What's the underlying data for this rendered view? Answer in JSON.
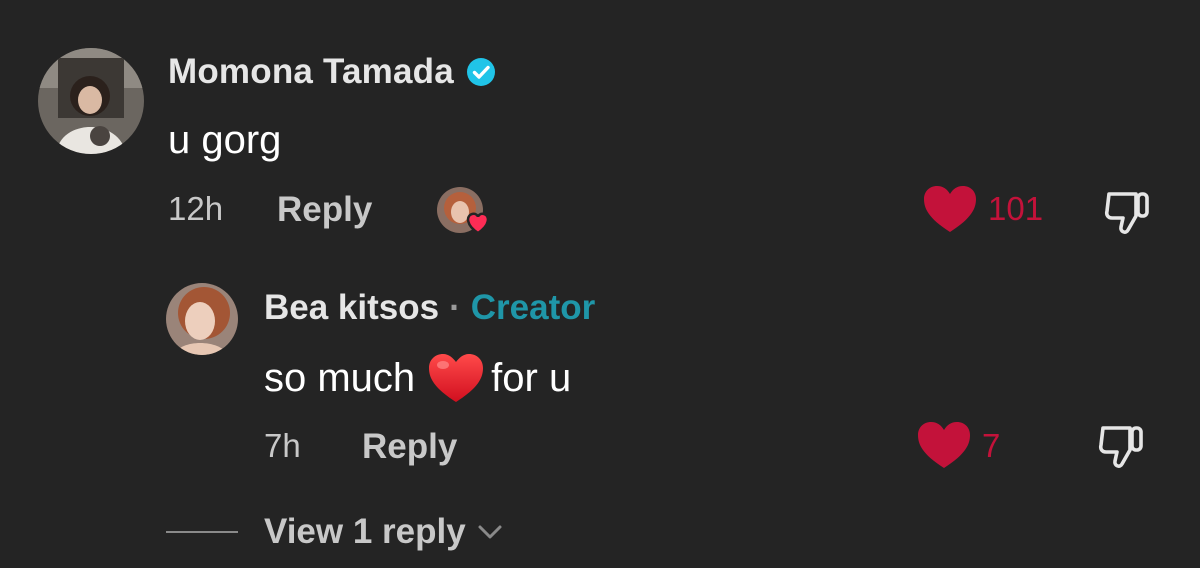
{
  "comments": [
    {
      "username": "Momona Tamada",
      "verified": true,
      "text": "u gorg",
      "time": "12h",
      "reply_label": "Reply",
      "likes": "101",
      "liked_by_creator": true,
      "liked": true
    }
  ],
  "reply": {
    "username": "Bea kitsos",
    "separator": "·",
    "badge": "Creator",
    "text_before": "so much",
    "text_after": "for u",
    "time": "7h",
    "reply_label": "Reply",
    "likes": "7",
    "liked": true
  },
  "view_replies_label": "View 1 reply",
  "colors": {
    "background": "#242424",
    "like_red": "#c3123a",
    "creator_teal": "#1f96a8",
    "verified_blue": "#20c4e8"
  },
  "icons": {
    "verified": "verified-badge-icon",
    "like": "heart-icon",
    "dislike": "thumbs-down-icon",
    "expand": "chevron-down-icon"
  }
}
